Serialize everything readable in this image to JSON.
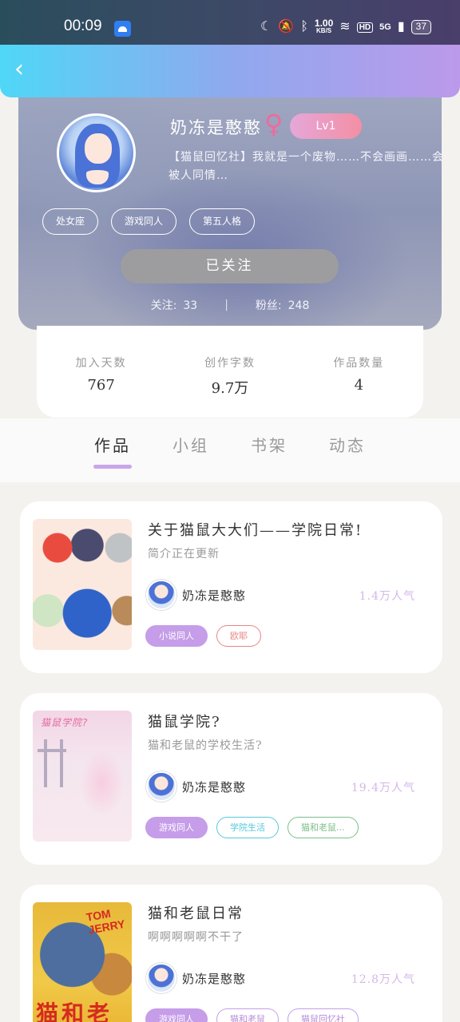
{
  "status_bar": {
    "time": "00:09",
    "net_speed_value": "1.00",
    "net_speed_unit": "KB/S",
    "hd": "HD",
    "signal": "5G",
    "battery": "37"
  },
  "header": {
    "back_icon": "chevron-left-icon"
  },
  "profile": {
    "nickname": "奶冻是憨憨",
    "gender_symbol": "♀",
    "level": "Lv1",
    "bio": "【猫鼠回忆社】我就是一个废物……不会画画……会被人同情…",
    "tags": [
      "处女座",
      "游戏同人",
      "第五人格"
    ],
    "follow_button": "已关注",
    "following_label": "关注:",
    "following_count": "33",
    "separator": "|",
    "fans_label": "粉丝:",
    "fans_count": "248"
  },
  "stats": [
    {
      "label": "加入天数",
      "value": "767"
    },
    {
      "label": "创作字数",
      "value": "9.7万"
    },
    {
      "label": "作品数量",
      "value": "4"
    }
  ],
  "tabs": [
    {
      "label": "作品",
      "active": true
    },
    {
      "label": "小组",
      "active": false
    },
    {
      "label": "书架",
      "active": false
    },
    {
      "label": "动态",
      "active": false
    }
  ],
  "works": [
    {
      "title": "关于猫鼠大大们——学院日常!",
      "desc": "简介正在更新",
      "author": "奶冻是憨憨",
      "popularity": "1.4万人气",
      "tags": [
        "小说同人",
        "欧耶"
      ]
    },
    {
      "title": "猫鼠学院?",
      "desc": "猫和老鼠的学校生活?",
      "cover_text": "猫鼠学院?",
      "author": "奶冻是憨憨",
      "popularity": "19.4万人气",
      "tags": [
        "游戏同人",
        "学院生活",
        "猫和老鼠..."
      ]
    },
    {
      "title": "猫和老鼠日常",
      "desc": "啊啊啊啊啊不干了",
      "cover_logo": "TOM JERRY",
      "cover_text": "猫和老鼠",
      "author": "奶冻是憨憨",
      "popularity": "12.8万人气",
      "tags": [
        "游戏同人",
        "猫和老鼠",
        "猫鼠回忆社"
      ]
    }
  ],
  "colors": {
    "header_gradient_start": "#4fd7f7",
    "header_gradient_end": "#bc99ea",
    "accent_purple": "#c59de9",
    "level_pink": "#f48fa4",
    "gender_pink": "#f06a9a"
  }
}
